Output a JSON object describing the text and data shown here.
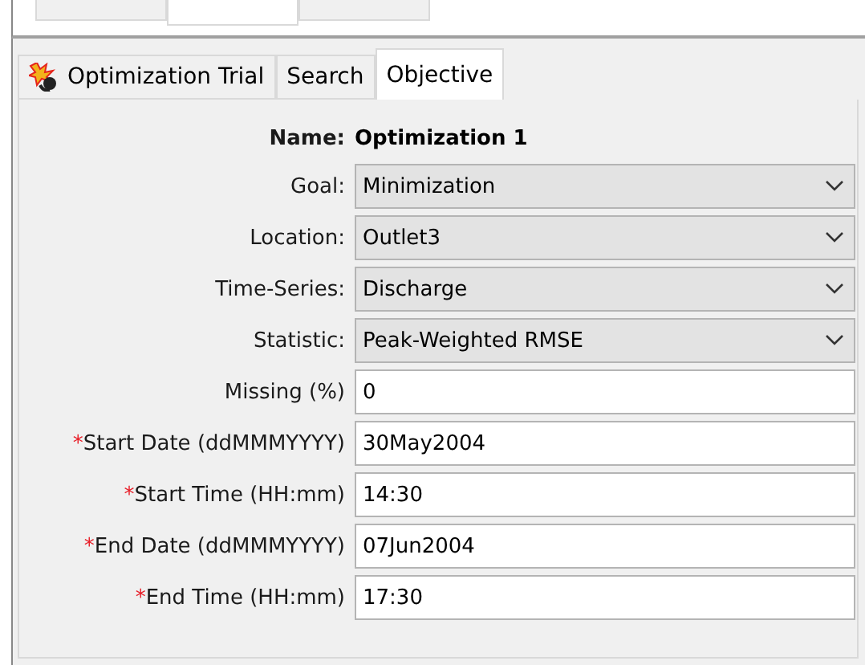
{
  "outer_tabs": [
    {
      "selected": false
    },
    {
      "selected": true
    },
    {
      "selected": false
    }
  ],
  "tabs": [
    {
      "kind": "icon",
      "label": "Optimization Trial",
      "selected": false
    },
    {
      "kind": "plain",
      "label": "Search",
      "selected": false
    },
    {
      "kind": "plain",
      "label": "Objective",
      "selected": true
    }
  ],
  "name": {
    "label": "Name:",
    "value": "Optimization 1"
  },
  "fields": [
    {
      "kind": "combo",
      "label": "Goal:",
      "value": "Minimization"
    },
    {
      "kind": "combo",
      "label": "Location:",
      "value": "Outlet3"
    },
    {
      "kind": "combo",
      "label": "Time-Series:",
      "value": "Discharge"
    },
    {
      "kind": "combo",
      "label": "Statistic:",
      "value": "Peak-Weighted RMSE"
    },
    {
      "kind": "text",
      "label": "Missing (%)",
      "value": "0"
    },
    {
      "kind": "text",
      "marker": "*",
      "label": "Start Date (ddMMMYYYY)",
      "value": "30May2004"
    },
    {
      "kind": "text",
      "marker": "*",
      "label": "Start Time (HH:mm)",
      "value": "14:30"
    },
    {
      "kind": "text",
      "marker": "*",
      "label": "End Date (ddMMMYYYY)",
      "value": "07Jun2004"
    },
    {
      "kind": "text",
      "marker": "*",
      "label": "End Time (HH:mm)",
      "value": "17:30"
    }
  ]
}
